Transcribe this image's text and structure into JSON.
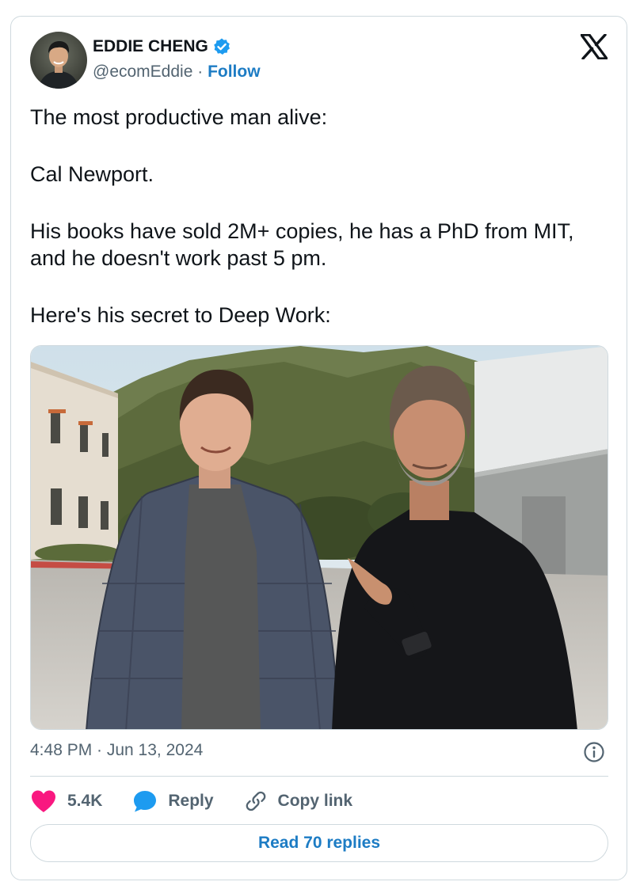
{
  "author": {
    "name": "EDDIE CHENG",
    "handle": "@ecomEddie",
    "separator": " · ",
    "follow_label": "Follow",
    "verified": true
  },
  "tweet": {
    "lines": [
      "The most productive man alive:",
      "Cal Newport.",
      "His books have sold 2M+ copies, he has a PhD from MIT, and he doesn't work past 5 pm.",
      "Here's his secret to Deep Work:"
    ],
    "timestamp": "4:48 PM · Jun 13, 2024"
  },
  "actions": {
    "likes": "5.4K",
    "reply_label": "Reply",
    "copy_label": "Copy link"
  },
  "read_replies_label": "Read 70 replies",
  "colors": {
    "accent": "#1d7cc4",
    "like": "#f91880",
    "text": "#0f1419",
    "muted": "#536471",
    "border": "#cfd9de"
  },
  "icons": [
    "x-logo-icon",
    "verified-badge-icon",
    "info-icon",
    "heart-icon",
    "reply-bubble-icon",
    "link-icon"
  ]
}
